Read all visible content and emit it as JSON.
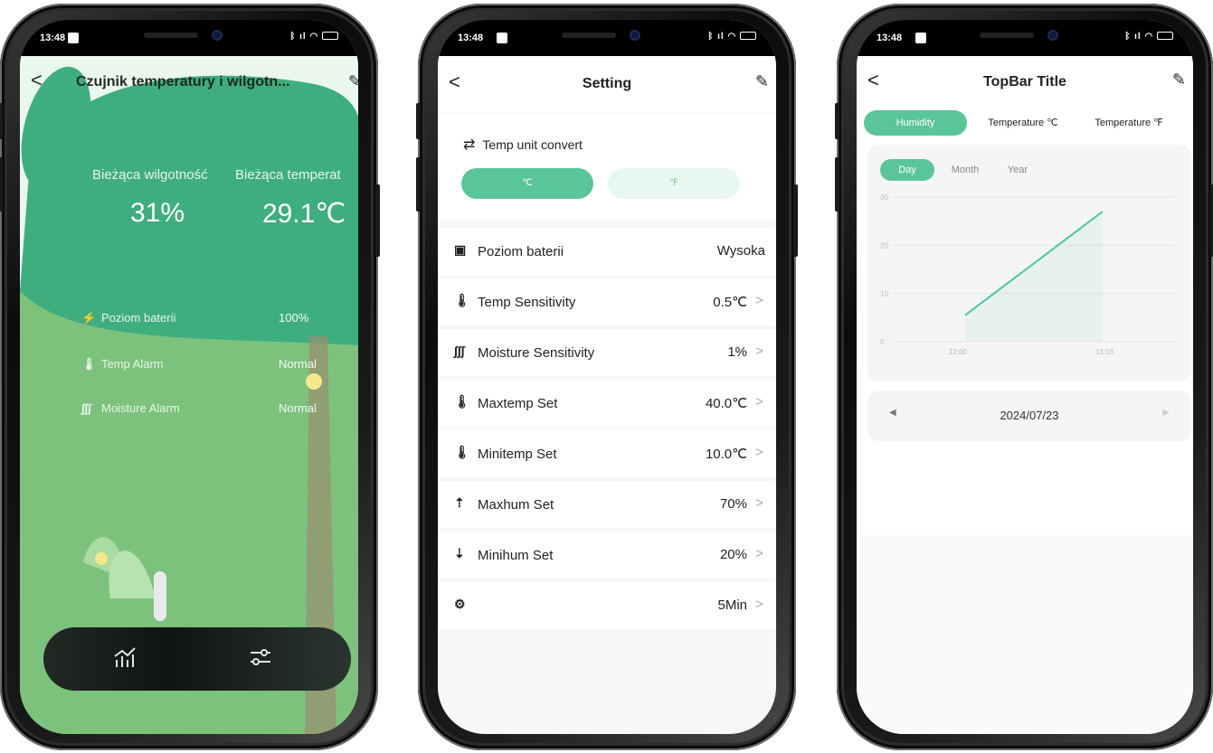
{
  "status_bar": {
    "time": "13:48"
  },
  "phone1": {
    "header": {
      "back_glyph": "<",
      "title": "Czujnik temperatury i wilgotn..."
    },
    "current": {
      "humidity_label": "Bieżąca wilgotność",
      "humidity_value": "31%",
      "temperature_label": "Bieżąca temperat",
      "temperature_value": "29.1℃"
    },
    "rows": [
      {
        "icon": "battery-icon",
        "label": "Poziom baterii",
        "value": "100%"
      },
      {
        "icon": "thermometer-icon",
        "label": "Temp Alarm",
        "value": "Normal"
      },
      {
        "icon": "moisture-icon",
        "label": "Moisture Alarm",
        "value": "Normal"
      }
    ],
    "bottom_nav": {
      "chart_icon": "chart-icon",
      "settings_icon": "sliders-icon"
    },
    "colors": {
      "accent": "#3fae7f",
      "background": "#7bc27e",
      "bar": "#141a17"
    }
  },
  "phone2": {
    "header": {
      "back_glyph": "<",
      "title": "Setting"
    },
    "unit_convert": {
      "label": "Temp unit convert",
      "celsius": "℃",
      "fahrenheit": "℉",
      "selected": "℃"
    },
    "items": [
      {
        "icon": "battery-icon",
        "label": "Poziom baterii",
        "value": "Wysoka",
        "chevron": ""
      },
      {
        "icon": "thermometer-icon",
        "label": "Temp Sensitivity",
        "value": "0.5℃",
        "chevron": ">"
      },
      {
        "icon": "moisture-icon",
        "label": "Moisture Sensitivity",
        "value": "1%",
        "chevron": ">"
      },
      {
        "icon": "thermometer-up-icon",
        "label": "Maxtemp Set",
        "value": "40.0℃",
        "chevron": ">"
      },
      {
        "icon": "thermometer-down-icon",
        "label": "Minitemp Set",
        "value": "10.0℃",
        "chevron": ">"
      },
      {
        "icon": "humidity-up-icon",
        "label": "Maxhum Set",
        "value": "70%",
        "chevron": ">"
      },
      {
        "icon": "humidity-down-icon",
        "label": "Minihum Set",
        "value": "20%",
        "chevron": ">"
      },
      {
        "icon": "gear-icon",
        "label": "",
        "value": "5Min",
        "chevron": ">"
      }
    ],
    "colors": {
      "accent": "#5bc59a",
      "accent_light": "#e8f7f0"
    }
  },
  "phone3": {
    "header": {
      "back_glyph": "<",
      "title": "TopBar Title"
    },
    "tabs": [
      "Humidity",
      "Temperature ℃",
      "Temperature ℉"
    ],
    "active_tab": "Humidity",
    "periods": [
      "Day",
      "Month",
      "Year"
    ],
    "active_period": "Day",
    "date_nav": {
      "prev": "◀",
      "date": "2024/07/23",
      "next": "▶"
    },
    "chart_data": {
      "type": "area",
      "x": [
        "12:00",
        "13:03"
      ],
      "y": [
        5.5,
        27.0
      ],
      "ylim": [
        0,
        30
      ],
      "yticks": [
        "0",
        "10",
        "20",
        "30"
      ],
      "xticks": [
        "12:00",
        "13:03"
      ],
      "grid": true,
      "title": "",
      "xlabel": "",
      "ylabel": ""
    },
    "colors": {
      "accent": "#5bc59a",
      "line": "#4cc79a"
    }
  }
}
